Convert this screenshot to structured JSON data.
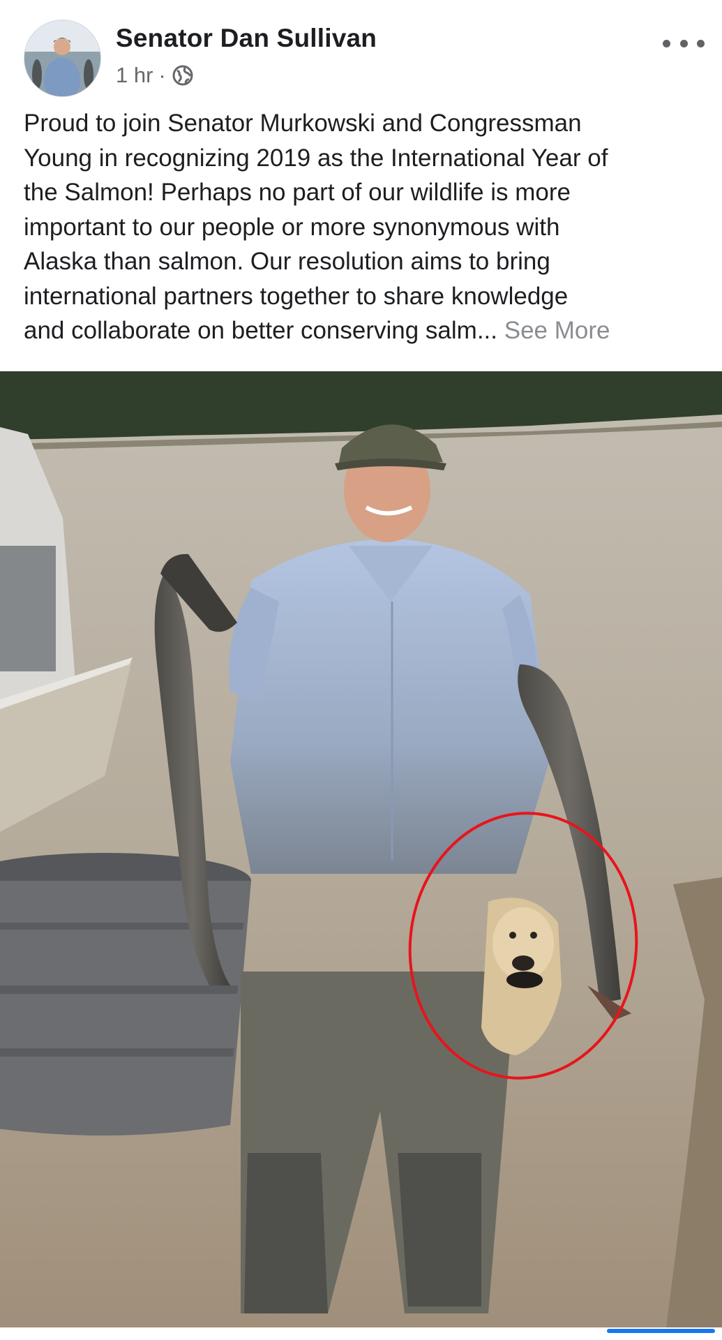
{
  "post": {
    "author": "Senator Dan Sullivan",
    "timestamp": "1 hr",
    "separator": "·",
    "privacy_icon": "globe-icon",
    "more_icon": "more-horizontal-icon",
    "text_lines": [
      "Proud to join Senator Murkowski and Congressman",
      "Young in recognizing 2019 as the International Year of",
      "the Salmon! Perhaps no part of our wildlife is more",
      "important to our people or more synonymous with",
      "Alaska than salmon. Our resolution aims to bring",
      "international partners together to share knowledge",
      "and collaborate on better conserving salm... "
    ],
    "see_more": "See More"
  },
  "colors": {
    "name": "#1c1e21",
    "meta": "#65676b",
    "see_more": "#8a8d91",
    "accent": "#1877f2",
    "annotation_circle": "#e8141b"
  }
}
